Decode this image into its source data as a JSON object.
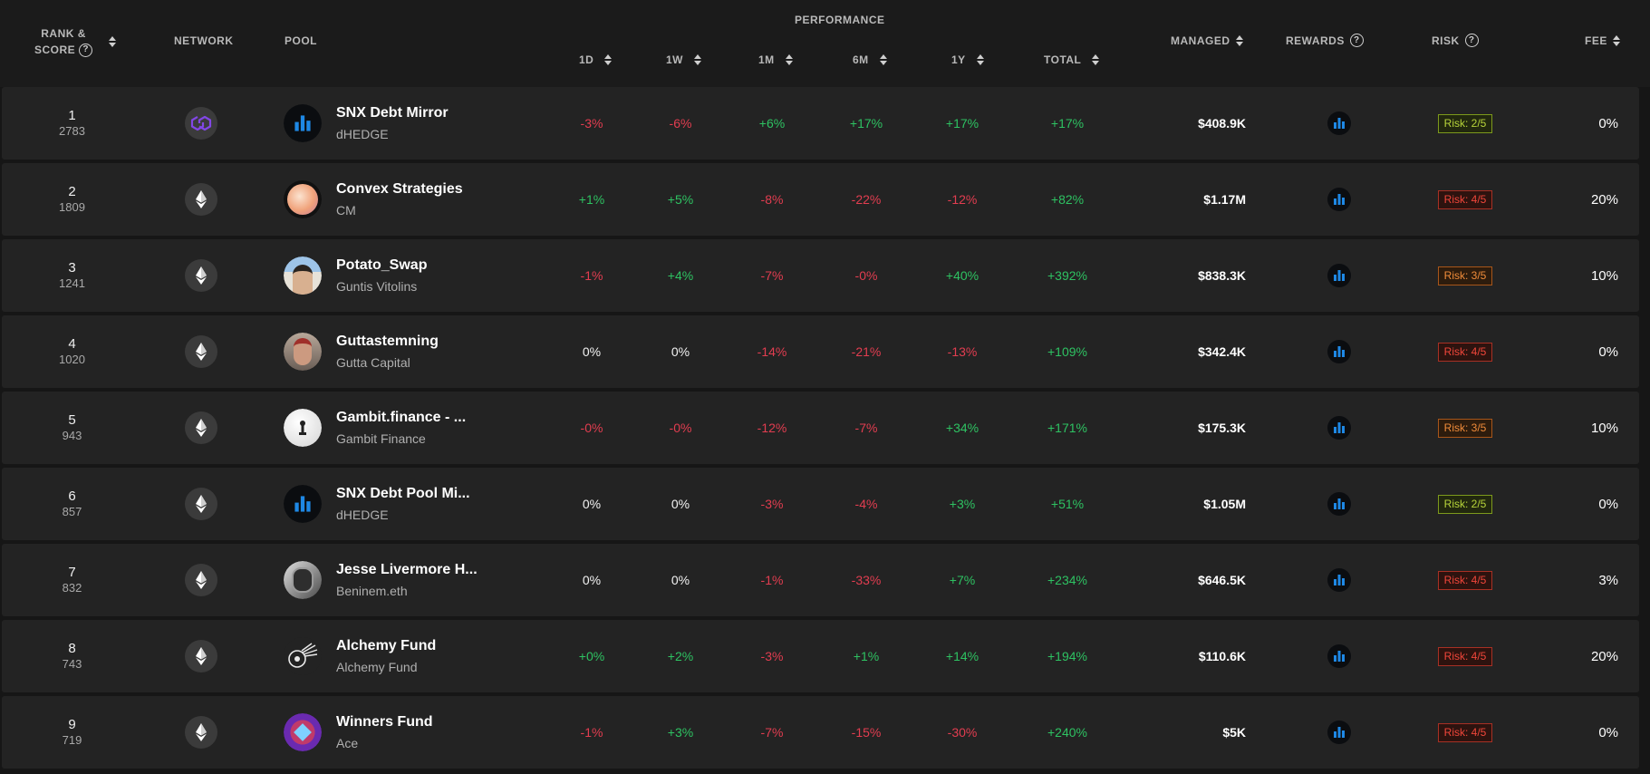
{
  "header": {
    "rank": "RANK &",
    "score": "SCORE",
    "network": "NETWORK",
    "pool": "POOL",
    "performance": "PERFORMANCE",
    "d1": "1D",
    "w1": "1W",
    "m1": "1M",
    "m6": "6M",
    "y1": "1Y",
    "total": "TOTAL",
    "managed": "MANAGED",
    "rewards": "REWARDS",
    "risk": "RISK",
    "fee": "FEE",
    "help_glyph": "?"
  },
  "colors": {
    "positive": "#2ec262",
    "negative": "#e23d50",
    "accent": "#1e88e5",
    "polygon": "#8247e5"
  },
  "rows": [
    {
      "rank": "1",
      "score": "2783",
      "network": "polygon",
      "name": "SNX Debt Mirror",
      "manager": "dHEDGE",
      "avatar": "dhedge",
      "d1": "-3%",
      "w1": "-6%",
      "m1": "+6%",
      "m6": "+17%",
      "y1": "+17%",
      "total": "+17%",
      "managed": "$408.9K",
      "risk": "Risk: 2/5",
      "risk_level": 2,
      "fee": "0%"
    },
    {
      "rank": "2",
      "score": "1809",
      "network": "ethereum",
      "name": "Convex Strategies",
      "manager": "CM",
      "avatar": "convex",
      "d1": "+1%",
      "w1": "+5%",
      "m1": "-8%",
      "m6": "-22%",
      "y1": "-12%",
      "total": "+82%",
      "managed": "$1.17M",
      "risk": "Risk: 4/5",
      "risk_level": 4,
      "fee": "20%"
    },
    {
      "rank": "3",
      "score": "1241",
      "network": "ethereum",
      "name": "Potato_Swap",
      "manager": "Guntis Vitolins",
      "avatar": "person-a",
      "d1": "-1%",
      "w1": "+4%",
      "m1": "-7%",
      "m6": "-0%",
      "y1": "+40%",
      "total": "+392%",
      "managed": "$838.3K",
      "risk": "Risk: 3/5",
      "risk_level": 3,
      "fee": "10%"
    },
    {
      "rank": "4",
      "score": "1020",
      "network": "ethereum",
      "name": "Guttastemning",
      "manager": "Gutta Capital",
      "avatar": "person-b",
      "d1": "0%",
      "w1": "0%",
      "m1": "-14%",
      "m6": "-21%",
      "y1": "-13%",
      "total": "+109%",
      "managed": "$342.4K",
      "risk": "Risk: 4/5",
      "risk_level": 4,
      "fee": "0%"
    },
    {
      "rank": "5",
      "score": "943",
      "network": "ethereum",
      "name": "Gambit.finance - ...",
      "manager": "Gambit Finance",
      "avatar": "gambit",
      "d1": "-0%",
      "w1": "-0%",
      "m1": "-12%",
      "m6": "-7%",
      "y1": "+34%",
      "total": "+171%",
      "managed": "$175.3K",
      "risk": "Risk: 3/5",
      "risk_level": 3,
      "fee": "10%"
    },
    {
      "rank": "6",
      "score": "857",
      "network": "ethereum",
      "name": "SNX Debt Pool Mi...",
      "manager": "dHEDGE",
      "avatar": "dhedge",
      "d1": "0%",
      "w1": "0%",
      "m1": "-3%",
      "m6": "-4%",
      "y1": "+3%",
      "total": "+51%",
      "managed": "$1.05M",
      "risk": "Risk: 2/5",
      "risk_level": 2,
      "fee": "0%"
    },
    {
      "rank": "7",
      "score": "832",
      "network": "ethereum",
      "name": "Jesse Livermore H...",
      "manager": "Beninem.eth",
      "avatar": "person-c",
      "d1": "0%",
      "w1": "0%",
      "m1": "-1%",
      "m6": "-33%",
      "y1": "+7%",
      "total": "+234%",
      "managed": "$646.5K",
      "risk": "Risk: 4/5",
      "risk_level": 4,
      "fee": "3%"
    },
    {
      "rank": "8",
      "score": "743",
      "network": "ethereum",
      "name": "Alchemy Fund",
      "manager": "Alchemy Fund",
      "avatar": "alchemy",
      "d1": "+0%",
      "w1": "+2%",
      "m1": "-3%",
      "m6": "+1%",
      "y1": "+14%",
      "total": "+194%",
      "managed": "$110.6K",
      "risk": "Risk: 4/5",
      "risk_level": 4,
      "fee": "20%"
    },
    {
      "rank": "9",
      "score": "719",
      "network": "ethereum",
      "name": "Winners Fund",
      "manager": "Ace",
      "avatar": "winners",
      "d1": "-1%",
      "w1": "+3%",
      "m1": "-7%",
      "m6": "-15%",
      "y1": "-30%",
      "total": "+240%",
      "managed": "$5K",
      "risk": "Risk: 4/5",
      "risk_level": 4,
      "fee": "0%"
    }
  ]
}
